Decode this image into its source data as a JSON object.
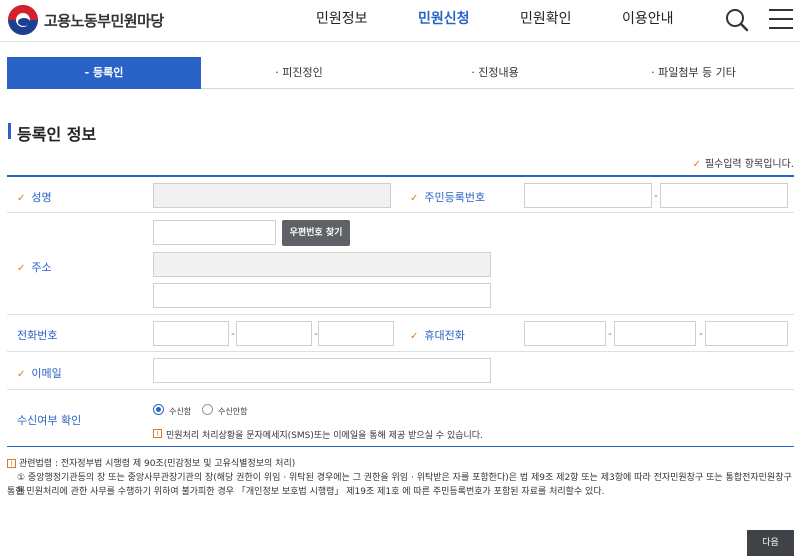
{
  "header": {
    "logo_text": "고용노동부민원마당",
    "nav": [
      "민원정보",
      "민원신청",
      "민원확인",
      "이용안내"
    ],
    "active_nav": "민원신청"
  },
  "steps": {
    "items": [
      "등록인",
      "피진정인",
      "진정내용",
      "파일첨부 등 기타"
    ],
    "active": "등록인"
  },
  "section": {
    "title": "등록인 정보",
    "required_note": "필수입력 항목입니다."
  },
  "form": {
    "name_label": "성명",
    "rrn_label": "주민등록번호",
    "address_label": "주소",
    "zip_button": "우편번호 찾기",
    "phone_label": "전화번호",
    "mobile_label": "휴대전화",
    "email_label": "이메일",
    "consent_label": "수신여부 확인",
    "consent_options": [
      "수신함",
      "수신안함"
    ],
    "consent_selected": "수신함",
    "consent_info": "민원처리 처리상황을 문자메세지(SMS)또는 이메일을 통해 제공 받으실 수 있습니다."
  },
  "law": {
    "title": "관련법령 : 전자정부법 시행령 제 90조(민감정보 및 고유식별정보의 처리)",
    "line1": "① 중앙행정기관등의 장 또는 중앙사무관장기관의 장(해당 권한이 위임 · 위탁된 경우에는 그 권한을 위임 · 위탁받은 자를 포함한다)은 법 제9조 제2항 또는 제3항에 따라 전자민원창구 또는 통합전자민원창구를",
    "line2": "통한 민원처리에 관한 사무를 수행하기 위하여 불가피한 경우 「개인정보 보호법 시행령」 제19조 제1호 에 따른 주민등록번호가 포함된 자료를 처리할수 있다."
  },
  "footer": {
    "next_button": "다음"
  },
  "colors": {
    "accent": "#2a63c7",
    "check": "#e07b1d",
    "button_dark": "#3f4247"
  }
}
